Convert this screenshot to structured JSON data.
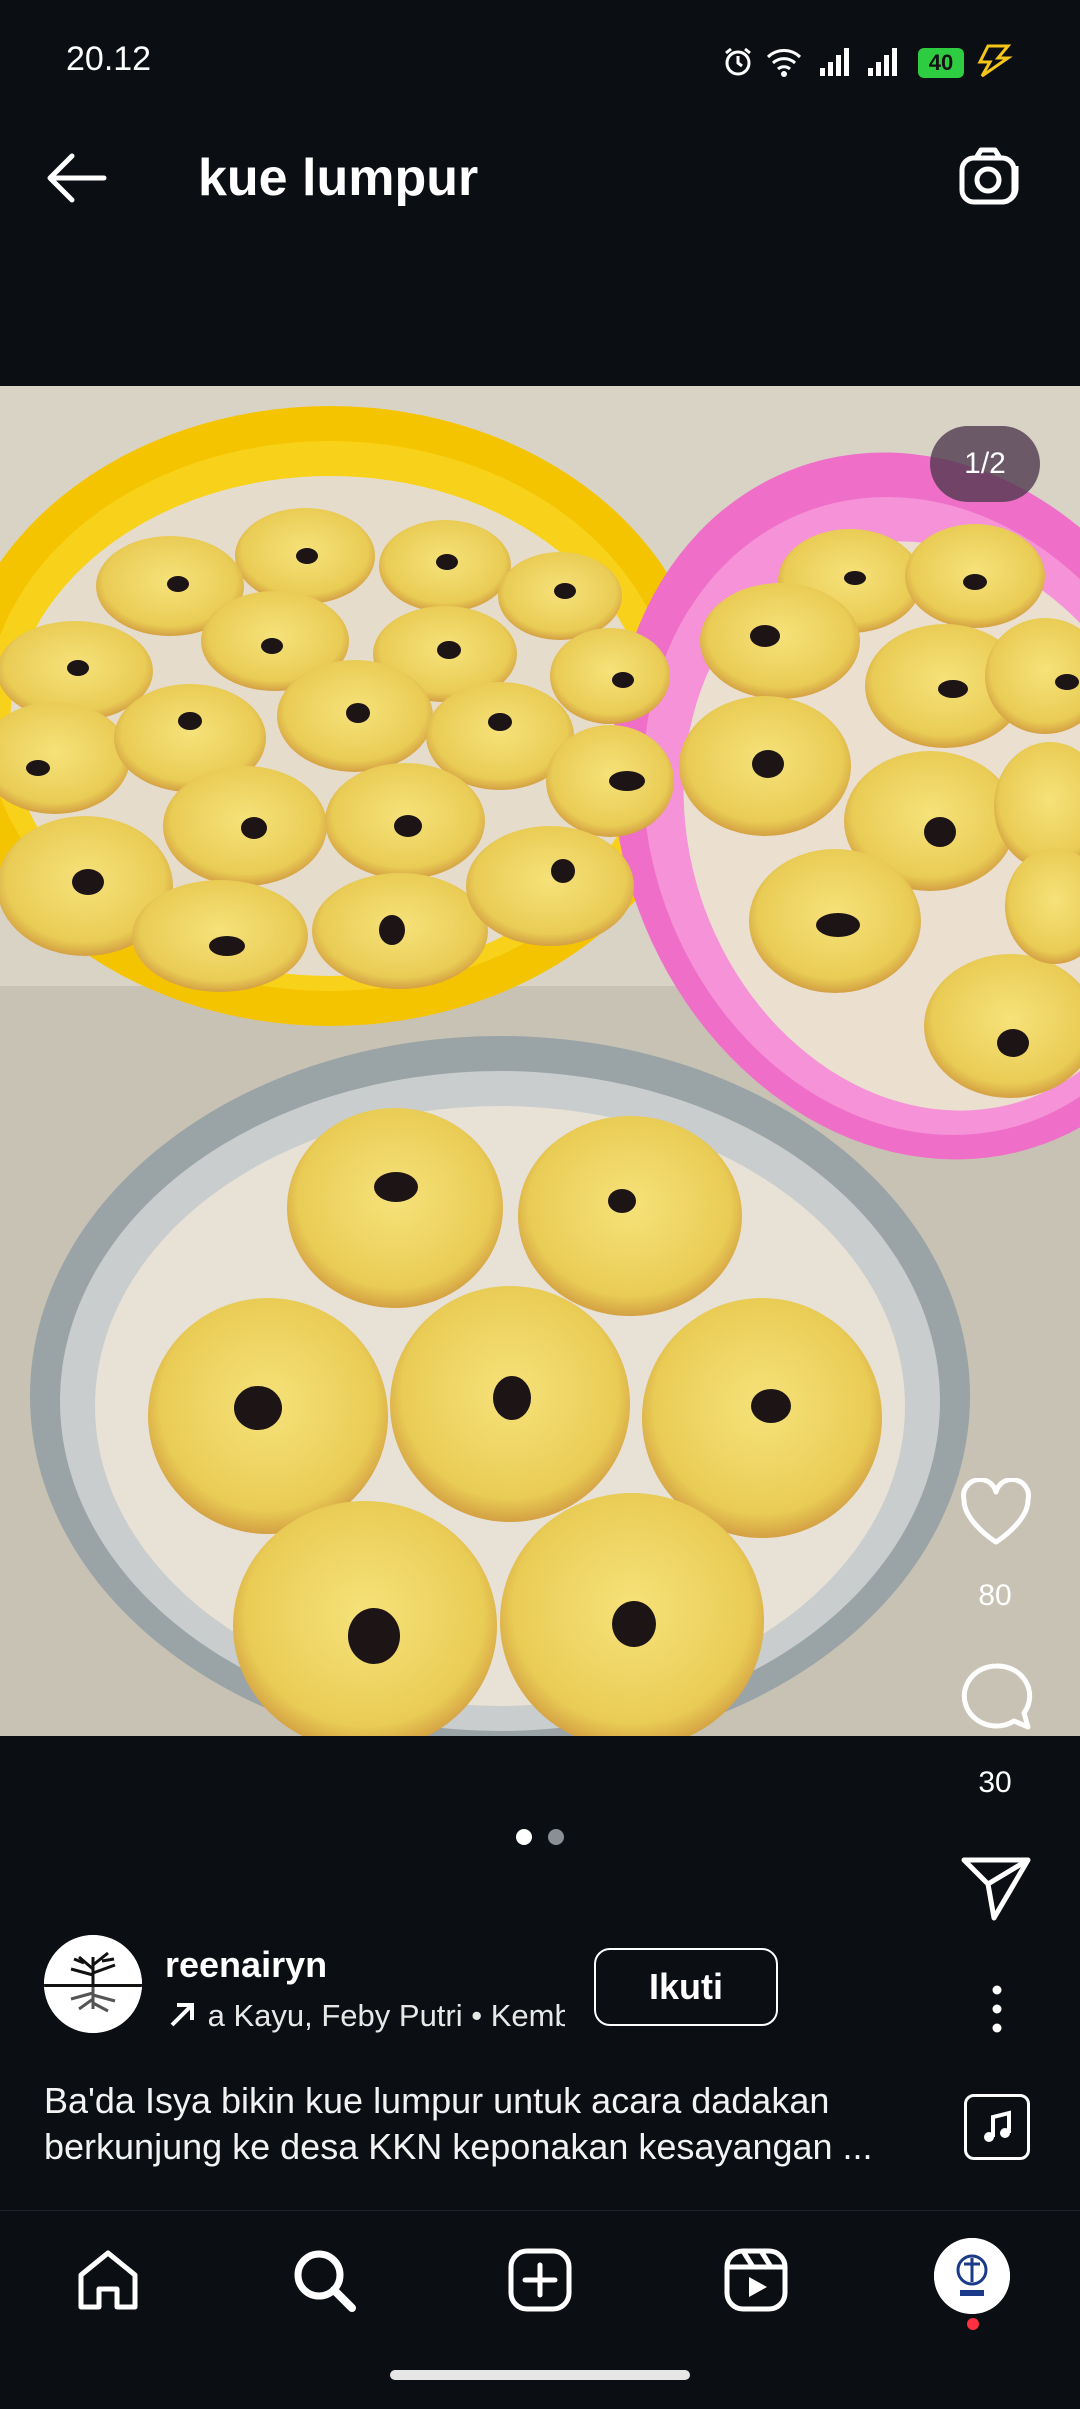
{
  "status_bar": {
    "time": "20.12",
    "battery": "40",
    "icons": [
      "alarm-icon",
      "wifi-icon",
      "signal-icon",
      "signal-icon",
      "battery-icon",
      "charging-icon"
    ]
  },
  "header": {
    "title": "kue lumpur",
    "back_icon": "arrow-left-icon",
    "camera_icon": "camera-icon"
  },
  "post": {
    "counter": "1/2",
    "likes": "80",
    "comments": "30",
    "pagination": {
      "total": 2,
      "active": 1
    },
    "author": {
      "username": "reenairyn",
      "subtitle": "a Kayu, Feby Putri • Kembali",
      "follow_label": "Ikuti"
    },
    "caption_lines": [
      "Ba'da Isya bikin kue lumpur untuk acara dadakan",
      "berkunjung ke desa KKN keponakan kesayangan ..."
    ]
  },
  "nav": {
    "items": [
      "home-icon",
      "search-icon",
      "create-icon",
      "reels-icon",
      "profile"
    ]
  },
  "colors": {
    "background": "#0b0f14",
    "text": "#ffffff",
    "notification": "#ff3040",
    "battery": "#2ecc40"
  }
}
